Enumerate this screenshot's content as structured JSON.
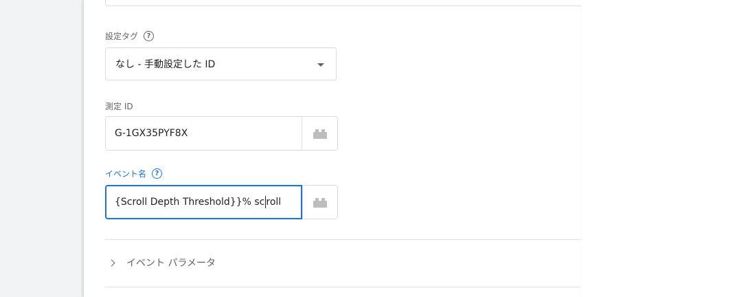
{
  "config_tag": {
    "label": "設定タグ",
    "selected": "なし - 手動設定した ID"
  },
  "measurement_id": {
    "label": "測定 ID",
    "value": "G-1GX35PYF8X"
  },
  "event_name": {
    "label": "イベント名",
    "value_before_cursor": "{Scroll Depth Threshold}}% sc",
    "value_after_cursor": "roll"
  },
  "event_parameters": {
    "label": "イベント パラメータ"
  },
  "icons": {
    "help": "help-circle-icon",
    "variable": "variable-brick-icon",
    "dropdown": "caret-down-icon",
    "expand": "chevron-right-icon"
  },
  "colors": {
    "accent": "#1a73e8",
    "border": "#dadce0",
    "muted_text": "#5f6368"
  }
}
